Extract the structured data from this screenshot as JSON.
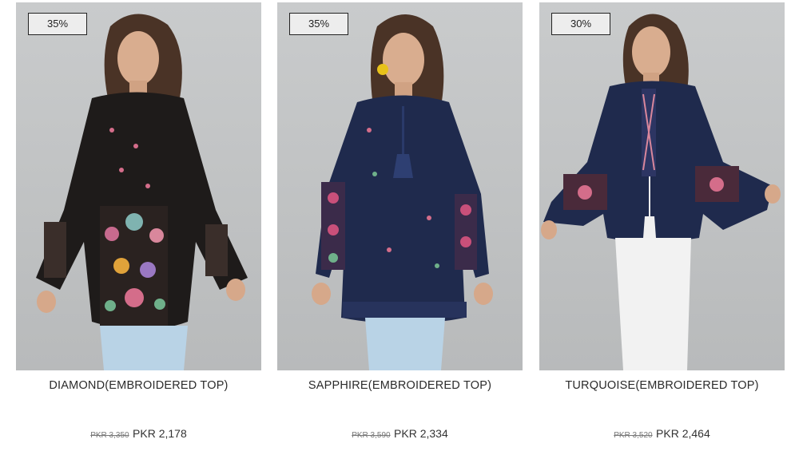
{
  "products": [
    {
      "discount": "35%",
      "name": "DIAMOND(EMBROIDERED TOP)",
      "old_price": "PKR 3,350",
      "new_price": "PKR 2,178"
    },
    {
      "discount": "35%",
      "name": "SAPPHIRE(EMBROIDERED TOP)",
      "old_price": "PKR 3,590",
      "new_price": "PKR 2,334"
    },
    {
      "discount": "30%",
      "name": "TURQUOISE(EMBROIDERED TOP)",
      "old_price": "PKR 3,520",
      "new_price": "PKR 2,464"
    }
  ],
  "colors": {
    "photo_background": "#c2c4c5",
    "top_black": "#1e1b1a",
    "top_navy": "#1f2a4d",
    "jeans_light_blue": "#b9d3e6",
    "pants_white": "#f2f2f2"
  }
}
